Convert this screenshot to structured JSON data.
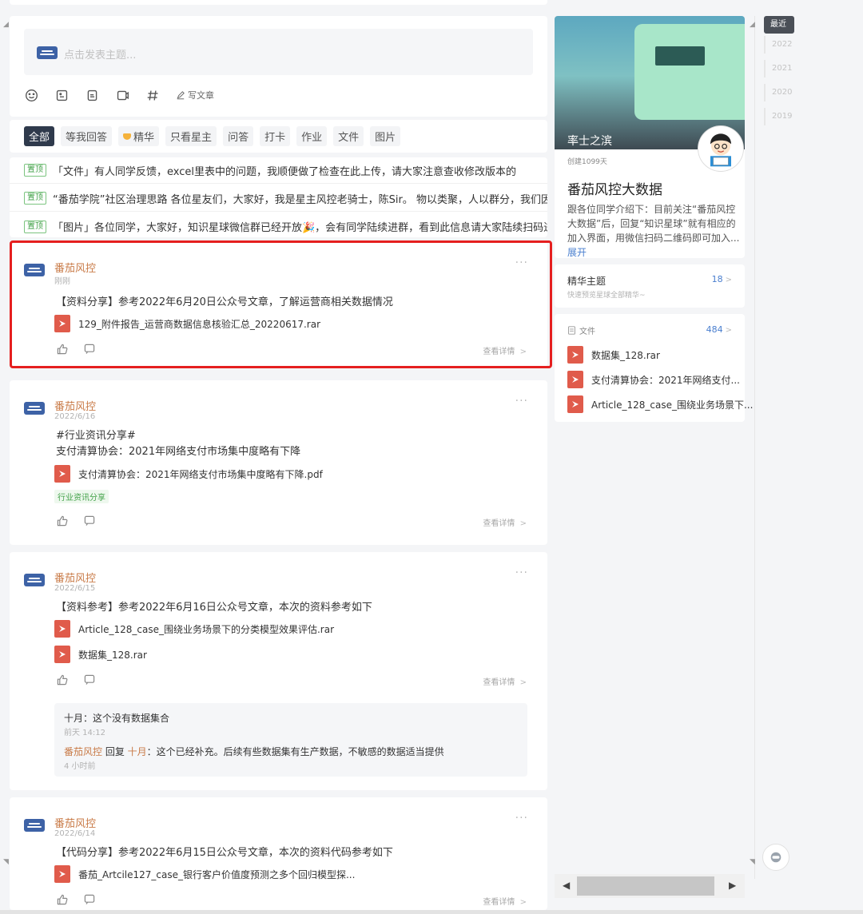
{
  "composer": {
    "placeholder": "点击发表主题...",
    "write_label": "写文章"
  },
  "filters": [
    "全部",
    "等我回答",
    "精华",
    "只看星主",
    "问答",
    "打卡",
    "作业",
    "文件",
    "图片"
  ],
  "pinned": {
    "tag": "置顶",
    "items": [
      "「文件」有人同学反馈，excel里表中的问题，我顺便做了检查在此上传，请大家注意查收修改版本的",
      "“番茄学院”社区治理思路 各位星友们，大家好，我是星主风控老骑士，陈Sir。 物以类聚，人以群分，我们因风控...",
      "「图片」各位同学，大家好，知识星球微信群已经开放🎉，会有同学陆续进群，看到此信息请大家陆续扫码进群..."
    ]
  },
  "posts": [
    {
      "author": "番茄风控",
      "date": "刚刚",
      "lines": [
        "【资料分享】参考2022年6月20日公众号文章，了解运营商相关数据情况"
      ],
      "files": [
        "129_附件报告_运营商数据信息核验汇总_20220617.rar"
      ],
      "detail": "查看详情"
    },
    {
      "author": "番茄风控",
      "date": "2022/6/16",
      "lines": [
        "#行业资讯分享#",
        "支付清算协会：2021年网络支付市场集中度略有下降"
      ],
      "files": [
        "支付清算协会：2021年网络支付市场集中度略有下降.pdf"
      ],
      "tag": "行业资讯分享",
      "detail": "查看详情"
    },
    {
      "author": "番茄风控",
      "date": "2022/6/15",
      "lines": [
        "【资料参考】参考2022年6月16日公众号文章，本次的资料参考如下"
      ],
      "files": [
        "Article_128_case_围绕业务场景下的分类模型效果评估.rar",
        "数据集_128.rar"
      ],
      "detail": "查看详情",
      "comments": {
        "c1": "十月：这个没有数据集合",
        "c1_time": "前天 14:12",
        "c2_author": "番茄风控",
        "c2_mid": " 回复 ",
        "c2_target": "十月",
        "c2_text": "：这个已经补充。后续有些数据集有生产数据，不敏感的数据适当提供",
        "c2_time": "4 小时前"
      }
    },
    {
      "author": "番茄风控",
      "date": "2022/6/14",
      "lines": [
        "【代码分享】参考2022年6月15日公众号文章，本次的资料代码参考如下"
      ],
      "files": [
        "番茄_Artcile127_case_银行客户价值度预测之多个回归模型探..."
      ],
      "detail": "查看详情"
    }
  ],
  "group": {
    "cover_title": "率士之滨",
    "created": "创建1099天",
    "name": "番茄风控大数据",
    "desc": "跟各位同学介绍下：目前关注“番茄风控大数据”后，回复“知识星球”就有相应的加入界面，用微信扫码二维码即可加入...",
    "expand": "展开"
  },
  "featured": {
    "title": "精华主题",
    "subtitle": "快速预览星球全部精华~",
    "count": "18"
  },
  "files_panel": {
    "title": "文件",
    "count": "484",
    "items": [
      "数据集_128.rar",
      "支付清算协会：2021年网络支付...",
      "Article_128_case_围绕业务场景下..."
    ]
  },
  "years": [
    "最近",
    "2022",
    "2021",
    "2020",
    "2019"
  ],
  "colors": {
    "accent": "#c97b48",
    "pin_green": "#42a148",
    "highlight": "#e51f1f",
    "file_red": "#e05b4b"
  }
}
